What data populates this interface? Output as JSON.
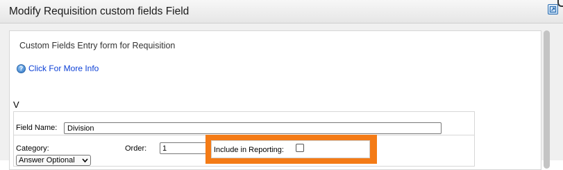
{
  "window": {
    "title": "Modify Requisition custom fields Field",
    "close_icon": "close-maximize-icon"
  },
  "form": {
    "heading": "Custom Fields Entry form for Requisition",
    "info_link": "Click For More Info",
    "info_icon": "help-icon",
    "section_letter": "V",
    "field_name_label": "Field Name:",
    "field_name_value": "Division",
    "category_label": "Category:",
    "category_selected": "Answer Optional",
    "order_label": "Order:",
    "order_value": "1",
    "include_reporting_label": "Include in Reporting:",
    "include_reporting_checked": false
  },
  "colors": {
    "highlight": "#f47b16",
    "link": "#0b3fd6"
  }
}
